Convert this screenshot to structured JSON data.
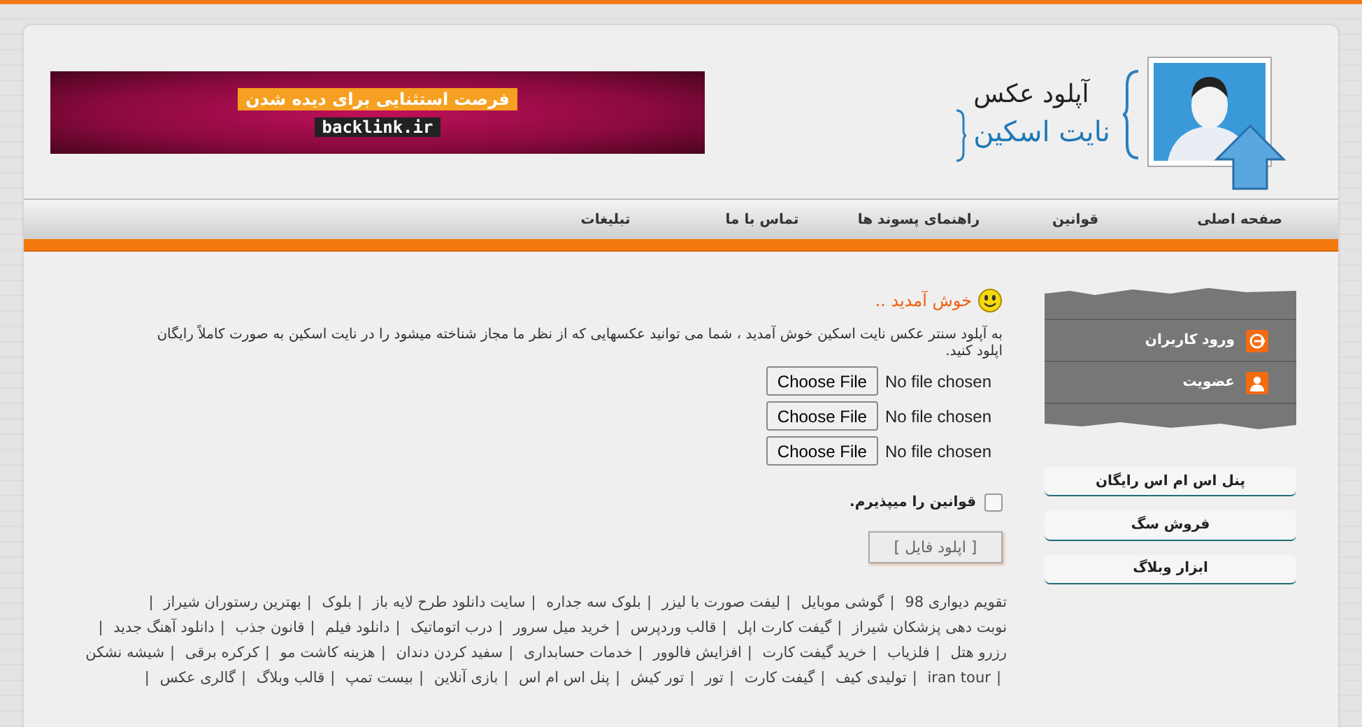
{
  "site": {
    "title": "آپلود عکس",
    "subtitle": "نایت اسکین"
  },
  "banner": {
    "headline": "فرصت استثنایی برای دیده شدن",
    "domain": "backlink.ir"
  },
  "nav": [
    "صفحه اصلی",
    "قوانین",
    "راهنمای پسوند ها",
    "تماس با ما",
    "تبلیغات"
  ],
  "welcome": {
    "heading": "خوش آمدید ..",
    "text": " به آپلود سنتر عکس نایت اسکین خوش آمدید ، شما می توانید عکسهایی که از نظر ما مجاز شناخته میشود را در نایت اسکین به صورت کاملاً رایگان اپلود کنید."
  },
  "file_inputs": [
    {
      "button": "Choose File",
      "status": "No file chosen"
    },
    {
      "button": "Choose File",
      "status": "No file chosen"
    },
    {
      "button": "Choose File",
      "status": "No file chosen"
    }
  ],
  "terms": {
    "label": "قوانین را میپذیرم.",
    "checked": false
  },
  "upload_button": "[ اپلود فایل ]",
  "sidebar": {
    "menu": [
      {
        "label": "ورود کاربران",
        "kind": "login"
      },
      {
        "label": "عضویت",
        "kind": "signup"
      }
    ],
    "links": [
      "پنل اس ام اس رایگان",
      "فروش سگ",
      "ابزار وبلاگ"
    ]
  },
  "footer_links": {
    "separator": "|",
    "items": [
      "تقویم دیواری 98",
      "گوشی موبایل",
      "لیفت صورت با لیزر",
      "بلوک سه جداره",
      "سایت دانلود طرح لایه باز",
      "بلوک",
      "بهترین رستوران شیراز",
      "نوبت دهی پزشکان شیراز",
      "گیفت کارت اپل",
      "قالب وردپرس",
      "خرید میل سرور",
      "درب اتوماتیک",
      "دانلود فیلم",
      "قانون جذب",
      "دانلود آهنگ جدید",
      "رزرو هتل",
      "فلزیاب",
      "خرید گیفت کارت",
      "افزایش فالوور",
      "خدمات حسابداری",
      "سفید کردن دندان",
      "هزینه کاشت مو",
      "کرکره برقی",
      "شیشه نشکن",
      "iran tour",
      "تولیدی کیف",
      "گیفت کارت",
      "تور",
      "تور کیش",
      "پنل اس ام اس",
      "بازی آنلاین",
      "بیست تمپ",
      "قالب وبلاگ",
      "گالری عکس"
    ]
  }
}
